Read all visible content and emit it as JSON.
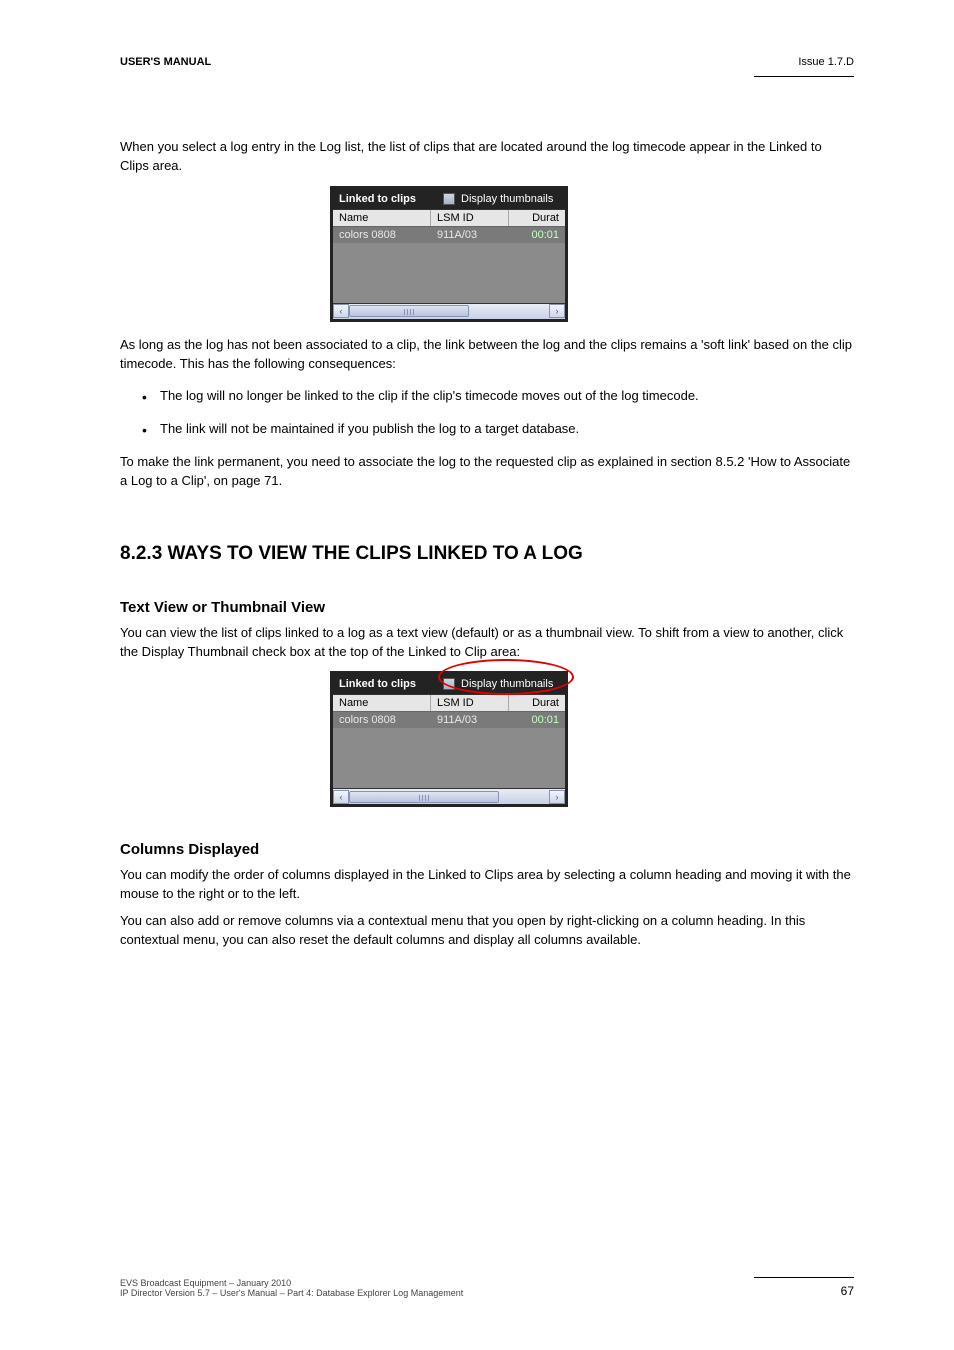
{
  "header": {
    "userManual": "USER'S MANUAL",
    "issue": "Issue 1.7.D"
  },
  "intro": "When you select a log entry in the Log list, the list of clips that are located around the log timecode appear in the Linked to Clips area.",
  "widget1": {
    "title": "Linked to clips",
    "checkboxLabel": "Display thumbnails",
    "cols": {
      "name": "Name",
      "lsm": "LSM ID",
      "dur": "Durat"
    },
    "row": {
      "name": "colors 0808",
      "lsm": "911A/03",
      "dur": "00:01"
    }
  },
  "afterWidget1": "As long as the log has not been associated to a clip, the link between the log and the clips remains a 'soft link' based on the clip timecode. This has the following consequences:",
  "bullets": [
    "The log will no longer be linked to the clip if the clip's timecode moves out of the log timecode.",
    "The link will not be maintained if you publish the log to a target database."
  ],
  "afterBullets": "To make the link permanent, you need to associate the log to the requested clip as explained in section 8.5.2 'How to Associate a Log to a Clip', on page 71.",
  "h2": "8.2.3  WAYS TO VIEW THE CLIPS LINKED TO A LOG",
  "h3a": "Text View or Thumbnail View",
  "text_h3a": "You can view the list of clips linked to a log as a text view (default) or as a thumbnail view. To shift from a view to another, click the Display Thumbnail check box at the top of the Linked to Clip area:",
  "widget2": {
    "title": "Linked to clips",
    "checkboxLabel": "Display thumbnails",
    "cols": {
      "name": "Name",
      "lsm": "LSM ID",
      "dur": "Durat"
    },
    "row": {
      "name": "colors 0808",
      "lsm": "911A/03",
      "dur": "00:01"
    }
  },
  "h3b": "Columns Displayed",
  "text_h3b_1": "You can modify the order of columns displayed in the Linked to Clips area by selecting a column heading and moving it with the mouse to the right or to the left.",
  "text_h3b_2": "You can also add or remove columns via a contextual menu that you open by right-clicking on a column heading. In this contextual menu, you can also reset the default columns and display all columns available.",
  "footer": {
    "page": "67",
    "leftLine1": "EVS Broadcast Equipment – January 2010",
    "leftLine2": "IP Director Version 5.7 – User's Manual – Part 4: Database Explorer Log Management"
  }
}
